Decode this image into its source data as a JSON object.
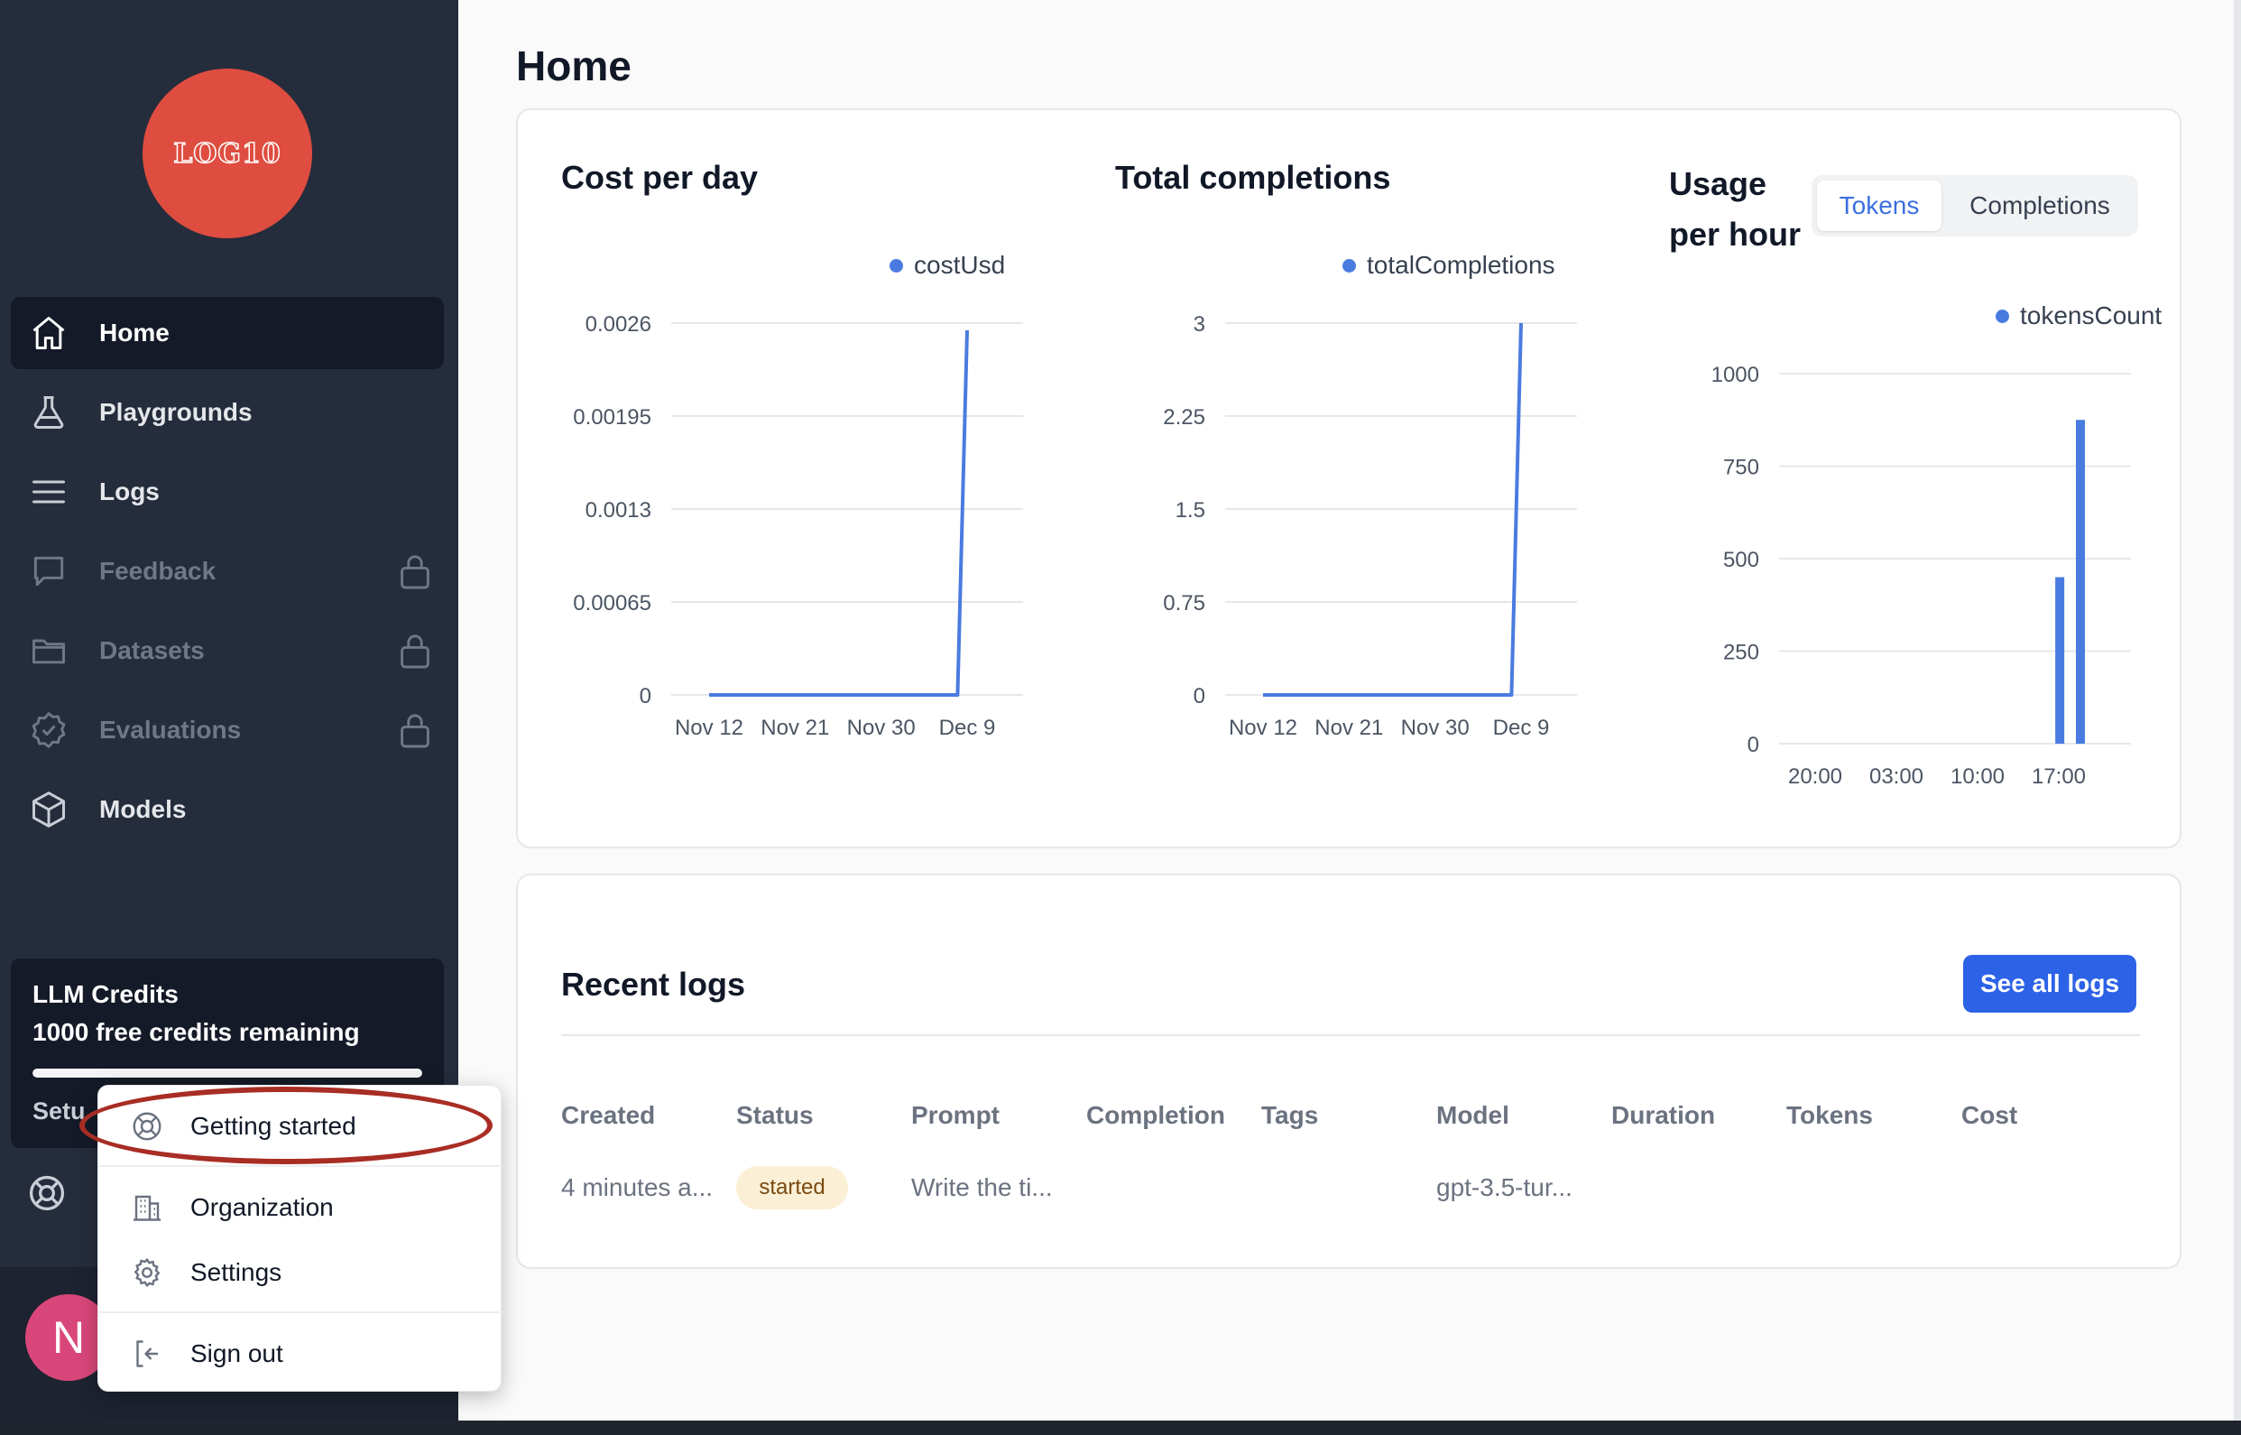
{
  "logo": {
    "text": "LOG10"
  },
  "sidebar": {
    "items": [
      {
        "label": "Home",
        "icon": "home-icon",
        "active": true,
        "locked": false
      },
      {
        "label": "Playgrounds",
        "icon": "flask-icon",
        "active": false,
        "locked": false
      },
      {
        "label": "Logs",
        "icon": "menu-lines-icon",
        "active": false,
        "locked": false
      },
      {
        "label": "Feedback",
        "icon": "chat-bubble-icon",
        "active": false,
        "locked": true
      },
      {
        "label": "Datasets",
        "icon": "folder-icon",
        "active": false,
        "locked": true
      },
      {
        "label": "Evaluations",
        "icon": "check-badge-icon",
        "active": false,
        "locked": true
      },
      {
        "label": "Models",
        "icon": "cube-icon",
        "active": false,
        "locked": false
      }
    ],
    "credits": {
      "title": "LLM Credits",
      "remaining": "1000 free credits remaining",
      "progress": 1.0,
      "setup_text": "Setu"
    },
    "avatar_initial": "N"
  },
  "user_menu": {
    "items": [
      {
        "label": "Getting started",
        "icon": "lifebuoy-icon"
      },
      {
        "label": "Organization",
        "icon": "building-icon"
      },
      {
        "label": "Settings",
        "icon": "gear-icon"
      },
      {
        "label": "Sign out",
        "icon": "sign-out-icon"
      }
    ],
    "highlight_color": "#a82d24"
  },
  "page": {
    "title": "Home"
  },
  "charts": {
    "cost": {
      "title": "Cost per day",
      "legend": "costUsd"
    },
    "completions": {
      "title": "Total completions",
      "legend": "totalCompletions"
    },
    "usage": {
      "title_line1": "Usage",
      "title_line2": "per hour",
      "legend": "tokensCount",
      "toggle": {
        "selected": "Tokens",
        "other": "Completions"
      }
    }
  },
  "chart_data": [
    {
      "type": "line",
      "title": "Cost per day",
      "series": [
        {
          "name": "costUsd",
          "x": [
            "Nov 12",
            "Dec 8",
            "Dec 9"
          ],
          "values": [
            0,
            0,
            0.00255
          ]
        }
      ],
      "x_ticks": [
        "Nov 12",
        "Nov 21",
        "Nov 30",
        "Dec 9"
      ],
      "y_ticks": [
        "0",
        "0.00065",
        "0.0013",
        "0.00195",
        "0.0026"
      ],
      "ylim": [
        0,
        0.0026
      ],
      "grid": true,
      "legend_position": "top-right",
      "color": "#4a7be0"
    },
    {
      "type": "line",
      "title": "Total completions",
      "series": [
        {
          "name": "totalCompletions",
          "x": [
            "Nov 12",
            "Dec 8",
            "Dec 9"
          ],
          "values": [
            0,
            0,
            3
          ]
        }
      ],
      "x_ticks": [
        "Nov 12",
        "Nov 21",
        "Nov 30",
        "Dec 9"
      ],
      "y_ticks": [
        "0",
        "0.75",
        "1.5",
        "2.25",
        "3"
      ],
      "ylim": [
        0,
        3
      ],
      "grid": true,
      "legend_position": "top-right",
      "color": "#4a7be0"
    },
    {
      "type": "bar",
      "title": "Usage per hour",
      "series": [
        {
          "name": "tokensCount",
          "x": [
            "16:00",
            "17:00"
          ],
          "values": [
            450,
            875
          ]
        }
      ],
      "x_ticks": [
        "20:00",
        "03:00",
        "10:00",
        "17:00"
      ],
      "y_ticks": [
        "0",
        "250",
        "500",
        "750",
        "1000"
      ],
      "ylim": [
        0,
        1000
      ],
      "grid": true,
      "legend_position": "top-right",
      "color": "#4a7be0"
    }
  ],
  "recent_logs": {
    "title": "Recent logs",
    "see_all": "See all logs",
    "columns": [
      "Created",
      "Status",
      "Prompt",
      "Completion",
      "Tags",
      "Model",
      "Duration",
      "Tokens",
      "Cost"
    ],
    "rows": [
      {
        "created": "4 minutes a...",
        "status": "started",
        "prompt": "Write the ti...",
        "completion": "",
        "tags": "",
        "model": "gpt-3.5-tur...",
        "duration": "",
        "tokens": "",
        "cost": ""
      }
    ]
  }
}
